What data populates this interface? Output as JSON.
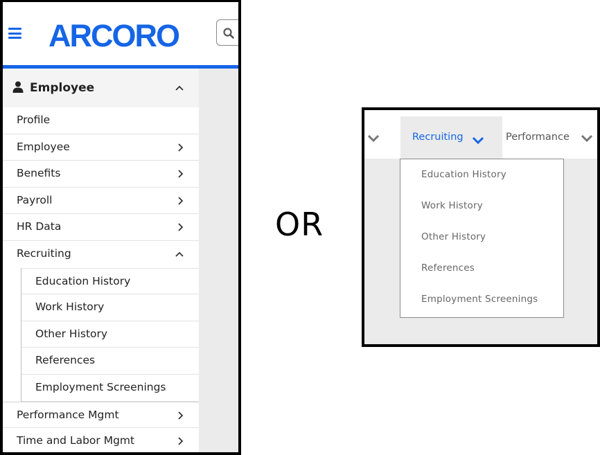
{
  "mobile": {
    "logo_text": "ARCORO",
    "search_icon": "search-icon",
    "menu_icon": "hamburger-icon",
    "header": {
      "title": "Employee",
      "icon": "person-icon"
    },
    "items": [
      {
        "label": "Profile"
      },
      {
        "label": "Employee"
      },
      {
        "label": "Benefits"
      },
      {
        "label": "Payroll"
      },
      {
        "label": "HR Data"
      },
      {
        "label": "Recruiting"
      }
    ],
    "recruiting_sub": [
      {
        "label": "Education History"
      },
      {
        "label": "Work History"
      },
      {
        "label": "Other History"
      },
      {
        "label": "References"
      },
      {
        "label": "Employment Screenings"
      }
    ],
    "after_items": [
      {
        "label": "Performance Mgmt"
      },
      {
        "label": "Time and Labor Mgmt"
      }
    ]
  },
  "separator": "OR",
  "desktop": {
    "active_tab": "Recruiting",
    "next_tab": "Performance",
    "dropdown": [
      "Education History",
      "Work History",
      "Other History",
      "References",
      "Employment Screenings"
    ]
  },
  "colors": {
    "brand_blue": "#1565e6",
    "panel_gray": "#ebebeb"
  }
}
